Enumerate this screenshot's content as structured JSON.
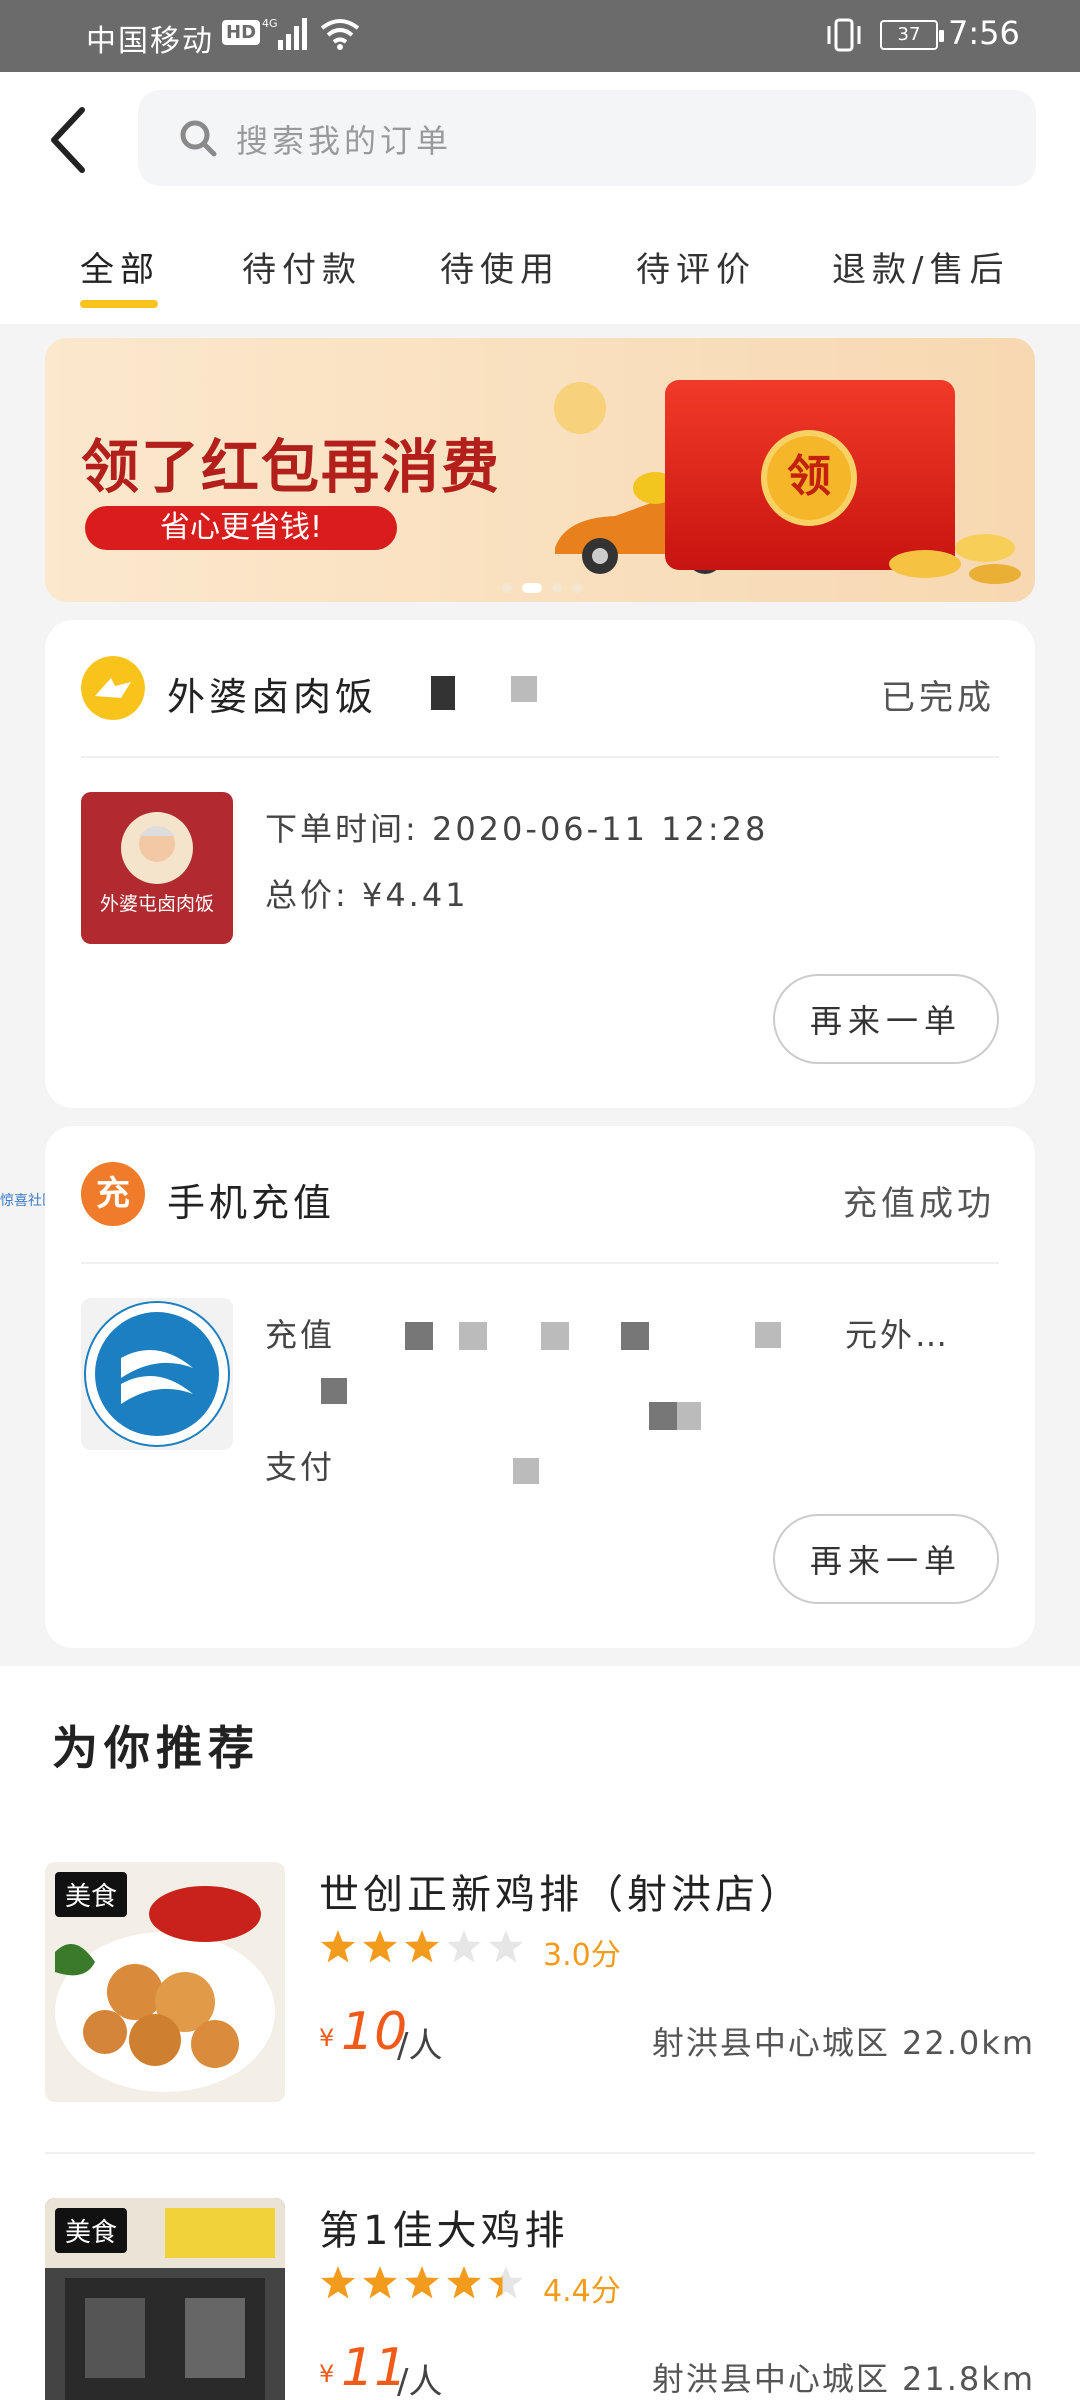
{
  "status_bar": {
    "carrier": "中国移动",
    "hd": "HD",
    "network": "4G",
    "battery": "37",
    "time": "7:56"
  },
  "header": {
    "back_icon": "back-arrow-icon",
    "search_placeholder": "搜索我的订单"
  },
  "tabs": [
    {
      "label": "全部",
      "active": true
    },
    {
      "label": "待付款"
    },
    {
      "label": "待使用"
    },
    {
      "label": "待评价"
    },
    {
      "label": "退款/售后"
    }
  ],
  "banner": {
    "title": "领了红包再消费",
    "subtitle": "省心更省钱!",
    "coin_label": "领"
  },
  "orders": [
    {
      "shop_name": "外婆卤肉饭",
      "status": "已完成",
      "thumb_text": "外婆屯卤肉饭",
      "order_time": "下单时间: 2020-06-11 12:28",
      "total": "总价: ¥4.41",
      "again": "再来一单"
    },
    {
      "icon_label": "充",
      "shop_name": "手机充值",
      "status": "充值成功",
      "line1": "充值",
      "line1_tail": "元外…",
      "line3": "支付",
      "again": "再来一单"
    }
  ],
  "side_tag": "惊喜社区",
  "recommend": {
    "title": "为你推荐",
    "items": [
      {
        "tag": "美食",
        "name": "世创正新鸡排（射洪店）",
        "rating": 3.0,
        "score": "3.0分",
        "price_symbol": "¥",
        "price": "10",
        "unit": "/人",
        "location": "射洪县中心城区 22.0km"
      },
      {
        "tag": "美食",
        "name": "第1佳大鸡排",
        "rating": 4.4,
        "score": "4.4分",
        "price_symbol": "¥",
        "price": "11",
        "unit": "/人",
        "location": "射洪县中心城区 21.8km"
      }
    ]
  },
  "colors": {
    "accent": "#f8c31a",
    "price": "#f25a1a",
    "star_on": "#f29b1d",
    "star_off": "#e6e6e6"
  }
}
